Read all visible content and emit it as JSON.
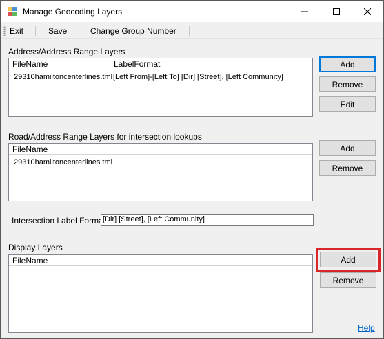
{
  "window": {
    "title": "Manage Geocoding Layers",
    "minimize_glyph": "—",
    "maximize_glyph": "☐",
    "close_glyph": "✕"
  },
  "menu": {
    "exit": "Exit",
    "save": "Save",
    "change_group": "Change Group Number"
  },
  "address_section": {
    "label": "Address/Address Range Layers",
    "columns": [
      "FileName",
      "LabelFormat"
    ],
    "rows": [
      {
        "file": "29310hamiltoncenterlines.tml",
        "format": "[Left From]-[Left To] [Dir] [Street], [Left Community]"
      }
    ],
    "add": "Add",
    "remove": "Remove",
    "edit": "Edit"
  },
  "road_section": {
    "label": "Road/Address Range Layers for intersection lookups",
    "columns": [
      "FileName"
    ],
    "rows": [
      {
        "file": "29310hamiltoncenterlines.tml"
      }
    ],
    "add": "Add",
    "remove": "Remove"
  },
  "intersection": {
    "label": "Intersection Label Format",
    "value": "[Dir] [Street], [Left Community]"
  },
  "display_section": {
    "label": "Display Layers",
    "columns": [
      "FileName"
    ],
    "add": "Add",
    "remove": "Remove"
  },
  "help": "Help",
  "colors": {
    "highlight": "#d9262b",
    "link": "#0066cc",
    "focus": "#0078d7"
  }
}
